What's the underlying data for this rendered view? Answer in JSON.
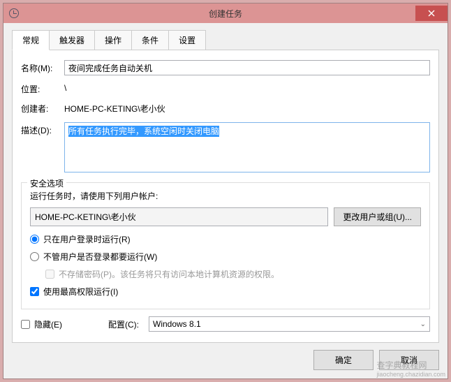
{
  "window": {
    "title": "创建任务"
  },
  "tabs": [
    "常规",
    "触发器",
    "操作",
    "条件",
    "设置"
  ],
  "general": {
    "name_label": "名称(M):",
    "name_value": "夜间完成任务自动关机",
    "location_label": "位置:",
    "location_value": "\\",
    "author_label": "创建者:",
    "author_value": "HOME-PC-KETING\\老小伙",
    "description_label": "描述(D):",
    "description_value": "所有任务执行完毕，系统空闲时关闭电脑"
  },
  "security": {
    "legend": "安全选项",
    "account_prompt": "运行任务时，请使用下列用户帐户:",
    "account_value": "HOME-PC-KETING\\老小伙",
    "change_user_btn": "更改用户或组(U)...",
    "radio_logged_on": "只在用户登录时运行(R)",
    "radio_any": "不管用户是否登录都要运行(W)",
    "no_password": "不存储密码(P)。该任务将只有访问本地计算机资源的权限。",
    "highest_priv": "使用最高权限运行(I)"
  },
  "config": {
    "hidden_label": "隐藏(E)",
    "config_label": "配置(C):",
    "config_value": "Windows 8.1"
  },
  "footer": {
    "ok": "确定",
    "cancel": "取消"
  },
  "watermark": {
    "main": "查字典教程网",
    "sub": "jiaocheng.chazidian.com"
  }
}
